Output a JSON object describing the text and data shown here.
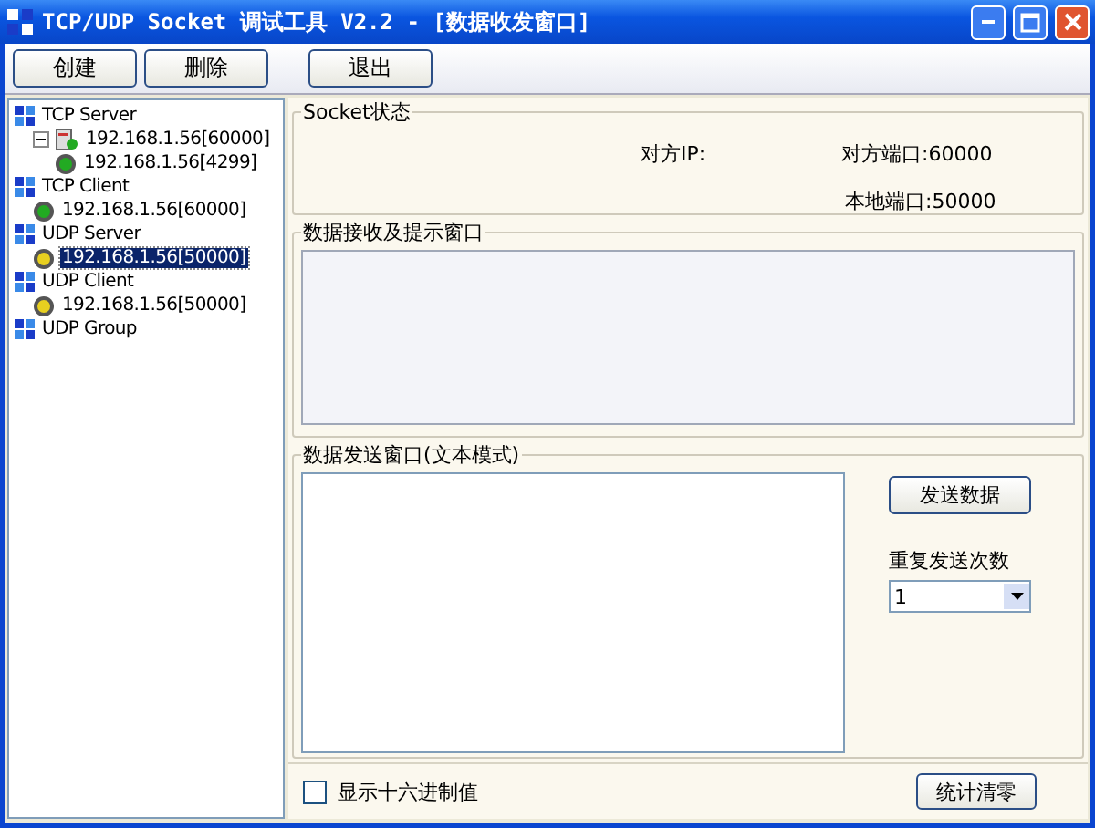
{
  "window": {
    "title": "TCP/UDP Socket 调试工具 V2.2 - [数据收发窗口]"
  },
  "toolbar": {
    "buttons": [
      "创建",
      "删除",
      "退出"
    ]
  },
  "tree": [
    {
      "label": "TCP Server",
      "kind": "group",
      "selected": false,
      "children": [
        {
          "label": "192.168.1.56[60000]",
          "kind": "server",
          "selected": false,
          "expanded": true,
          "children": [
            {
              "label": "192.168.1.56[4299]",
              "kind": "connection",
              "color": "#22aa22",
              "selected": false
            }
          ]
        }
      ]
    },
    {
      "label": "TCP Client",
      "kind": "group",
      "selected": false,
      "children": [
        {
          "label": "192.168.1.56[60000]",
          "kind": "connection",
          "color": "#22aa22",
          "selected": false
        }
      ]
    },
    {
      "label": "UDP Server",
      "kind": "group",
      "selected": false,
      "children": [
        {
          "label": "192.168.1.56[50000]",
          "kind": "connection",
          "color": "#e8d020",
          "selected": true
        }
      ]
    },
    {
      "label": "UDP Client",
      "kind": "group",
      "selected": false,
      "children": [
        {
          "label": "192.168.1.56[50000]",
          "kind": "connection",
          "color": "#e8d020",
          "selected": false
        }
      ]
    },
    {
      "label": "UDP Group",
      "kind": "group",
      "selected": false
    }
  ],
  "socket_status": {
    "title": "Socket状态",
    "remote_ip": "对方IP:",
    "remote_port": "对方端口:60000",
    "local_port": "本地端口:50000"
  },
  "receive": {
    "title": "数据接收及提示窗口"
  },
  "send": {
    "title": "数据发送窗口(文本模式)",
    "send_button": "发送数据",
    "repeat_label": "重复发送次数",
    "repeat_value": "1"
  },
  "bottom": {
    "hex_checkbox": {
      "label": "显示十六进制值",
      "checked": false
    },
    "clear_button": "统计清零"
  }
}
